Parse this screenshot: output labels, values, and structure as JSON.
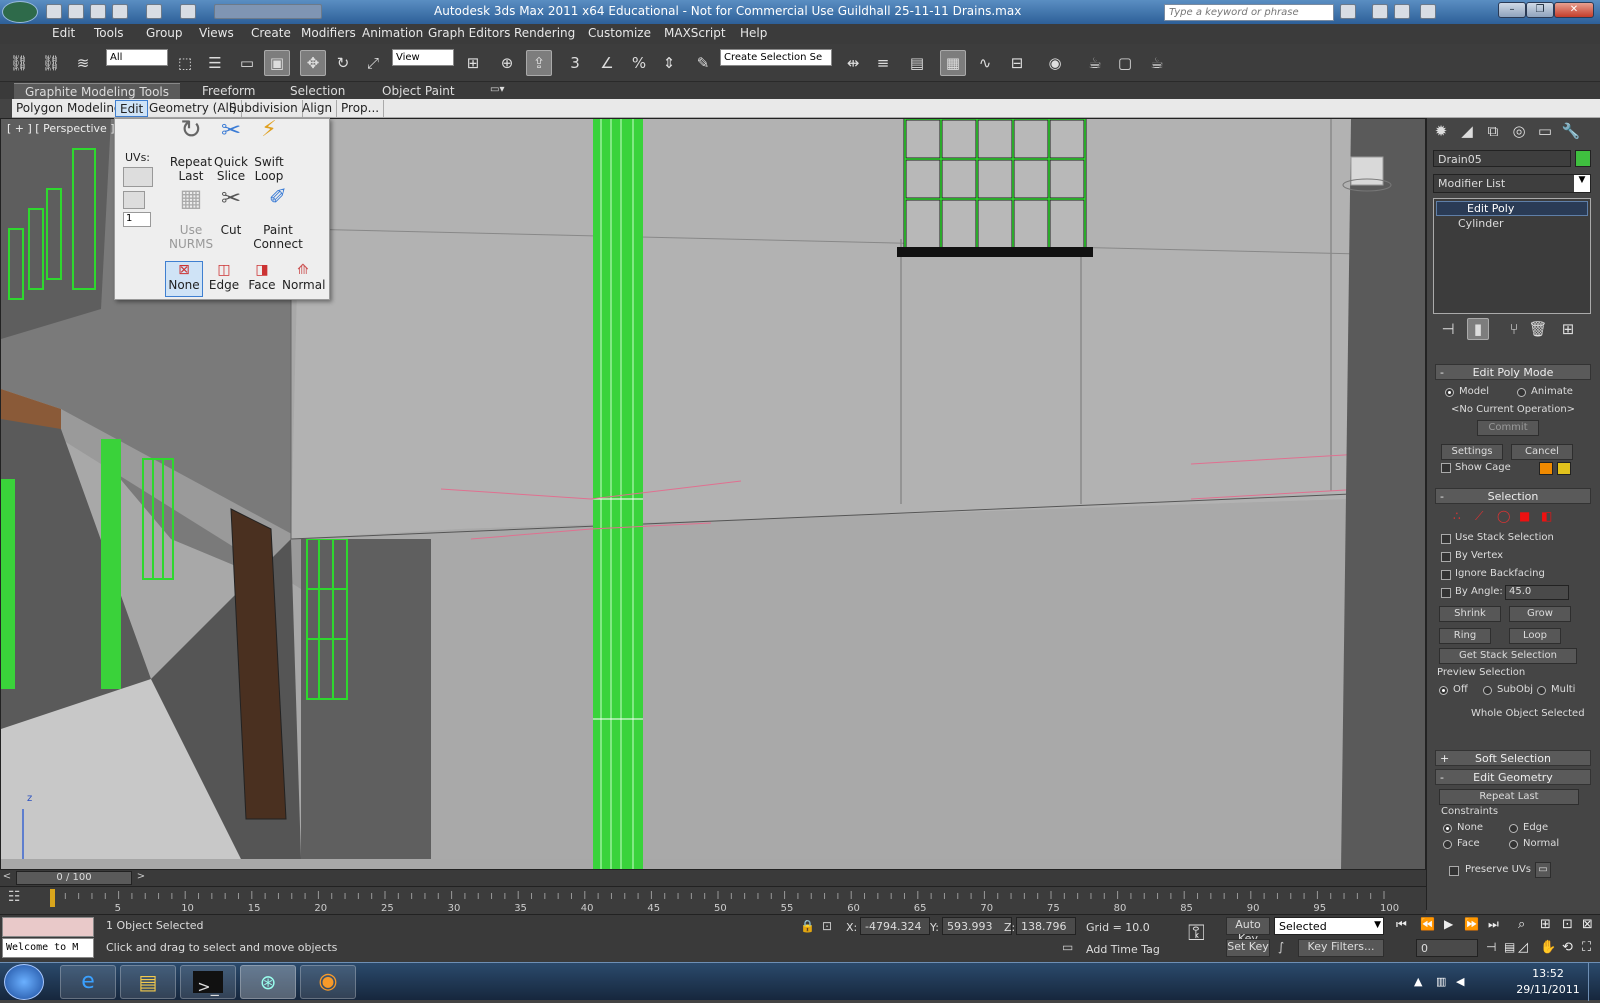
{
  "window": {
    "title": "Autodesk 3ds Max  2011 x64   Educational - Not for Commercial Use    Guildhall 25-11-11 Drains.max",
    "search_placeholder": "Type a keyword or phrase"
  },
  "menu": [
    "Edit",
    "Tools",
    "Group",
    "Views",
    "Create",
    "Modifiers",
    "Animation",
    "Graph Editors",
    "Rendering",
    "Customize",
    "MAXScript",
    "Help"
  ],
  "toolbar": {
    "selection_filter": "All",
    "ref_coord": "View",
    "named_selection": "Create Selection Se"
  },
  "ribbon": {
    "tabs": [
      "Graphite Modeling Tools",
      "Freeform",
      "Selection",
      "Object Paint"
    ],
    "panels": [
      "Polygon Modeling",
      "Edit",
      "Geometry (All)",
      "Subdivision",
      "Align",
      "Prop..."
    ]
  },
  "edit_flyout": {
    "uvs_label": "UVs:",
    "spinner_value": "1",
    "repeat_last": "Repeat\nLast",
    "quick_slice": "Quick\nSlice",
    "swift_loop": "Swift\nLoop",
    "use_nurms": "Use\nNURMS",
    "cut": "Cut",
    "paint_connect": "Paint\nConnect",
    "constraints": [
      "None",
      "Edge",
      "Face",
      "Normal"
    ]
  },
  "viewport": {
    "label": "[ + ] [ Perspective ] [ Sm",
    "axis_z": "z"
  },
  "command_panel": {
    "object_name": "Drain05",
    "object_color": "#3fbf3f",
    "modifier_list": "Modifier List",
    "stack": [
      "Edit Poly",
      "Cylinder"
    ],
    "edit_poly_mode": {
      "title": "Edit Poly Mode",
      "model": "Model",
      "animate": "Animate",
      "current_op": "<No Current Operation>",
      "commit": "Commit",
      "settings": "Settings",
      "cancel": "Cancel",
      "show_cage": "Show Cage"
    },
    "selection": {
      "title": "Selection",
      "use_stack": "Use Stack Selection",
      "by_vertex": "By Vertex",
      "ignore_backfacing": "Ignore Backfacing",
      "by_angle": "By Angle:",
      "angle_value": "45.0",
      "shrink": "Shrink",
      "grow": "Grow",
      "ring": "Ring",
      "loop": "Loop",
      "get_stack": "Get Stack Selection",
      "preview_title": "Preview Selection",
      "preview_off": "Off",
      "preview_subobj": "SubObj",
      "preview_multi": "Multi",
      "whole_object": "Whole Object Selected"
    },
    "soft_selection": "Soft Selection",
    "edit_geometry": {
      "title": "Edit Geometry",
      "repeat_last": "Repeat Last",
      "constraints": "Constraints",
      "none": "None",
      "edge": "Edge",
      "face": "Face",
      "normal": "Normal",
      "preserve_uvs": "Preserve UVs"
    }
  },
  "timeline": {
    "frame": "0 / 100",
    "ticks": [
      "5",
      "10",
      "15",
      "20",
      "25",
      "30",
      "35",
      "40",
      "45",
      "50",
      "55",
      "60",
      "65",
      "70",
      "75",
      "80",
      "85",
      "90",
      "95",
      "100"
    ]
  },
  "status": {
    "maxscript": "Welcome to M",
    "selected": "1 Object Selected",
    "prompt": "Click and drag to select and move objects",
    "x_label": "X:",
    "x": "-4794.324",
    "y_label": "Y:",
    "y": "593.993",
    "z_label": "Z:",
    "z": "138.796",
    "grid": "Grid = 10.0",
    "add_time_tag": "Add Time Tag",
    "auto_key": "Auto Key",
    "set_key": "Set Key",
    "selected_dropdown": "Selected",
    "key_filters": "Key Filters...",
    "current_frame": "0"
  },
  "taskbar": {
    "time": "13:52",
    "date": "29/11/2011"
  }
}
